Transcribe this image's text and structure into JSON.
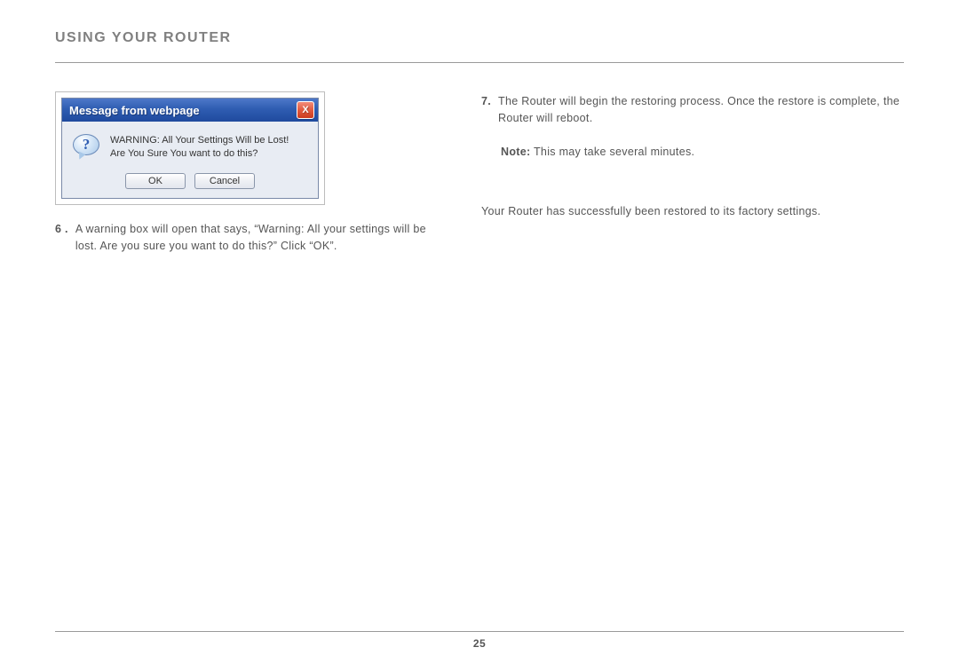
{
  "header": {
    "section_title": "USING YOUR ROUTER"
  },
  "dialog": {
    "title": "Message from webpage",
    "warning_line1": "WARNING: All Your Settings Will be Lost!",
    "warning_line2": "Are You Sure You want to do this?",
    "ok_label": "OK",
    "cancel_label": "Cancel",
    "icon_name": "question-icon",
    "close_glyph": "X"
  },
  "steps": {
    "six": {
      "num": "6 .",
      "text": "A warning box will open that says, “Warning: All your settings will be lost. Are you sure you want to do this?” Click “OK”."
    },
    "seven": {
      "num": "7.",
      "text": "The Router will begin the restoring process. Once the restore is complete, the Router will reboot."
    }
  },
  "note": {
    "label": "Note:",
    "text": " This may take several minutes."
  },
  "final_text": "Your Router has successfully been restored to its factory settings.",
  "footer": {
    "page_number": "25"
  }
}
